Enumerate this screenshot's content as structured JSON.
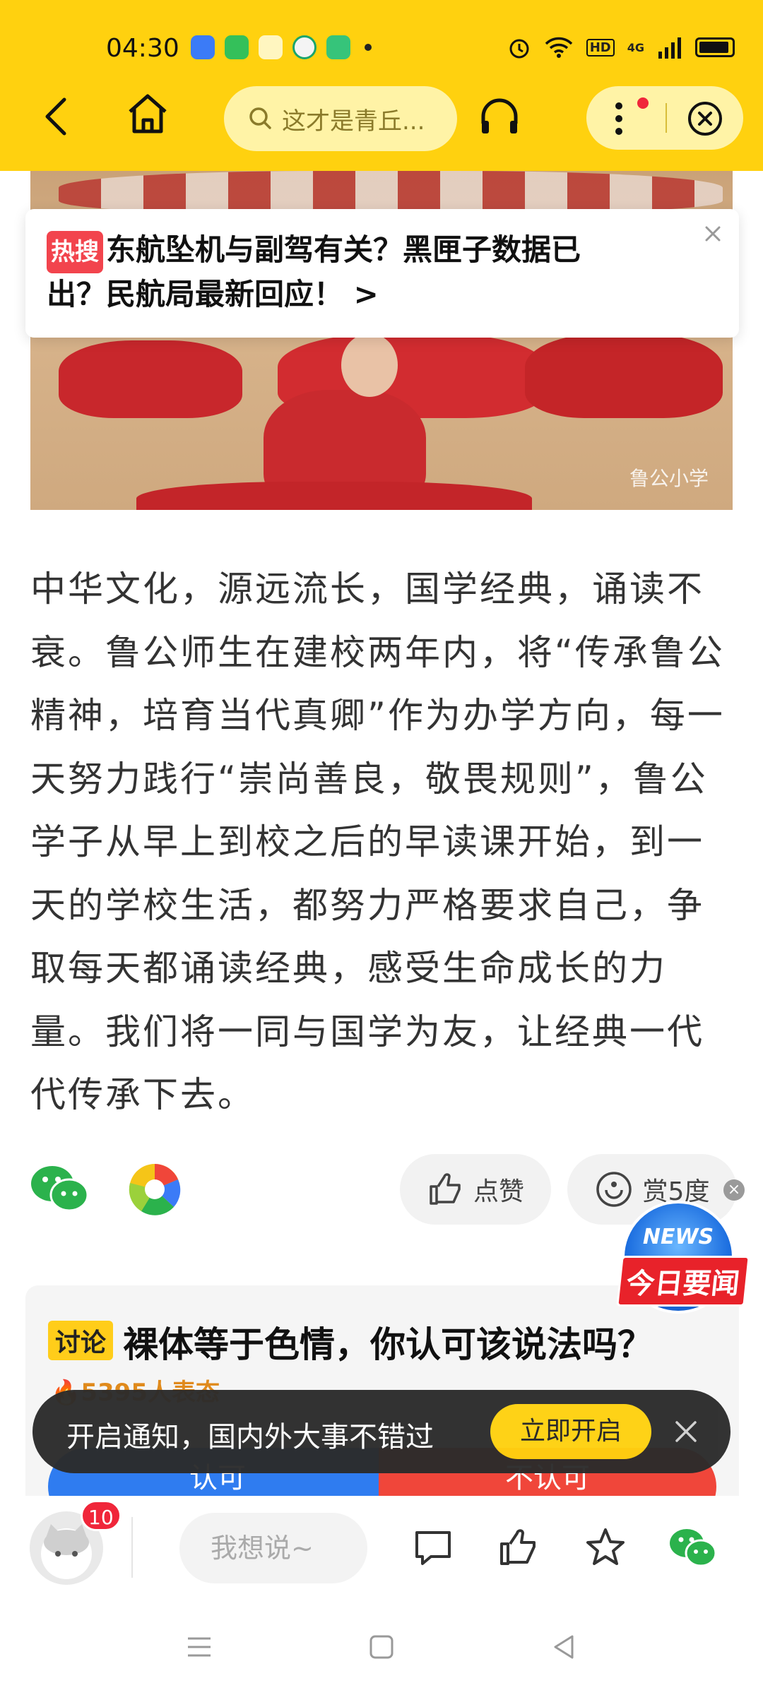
{
  "status_bar": {
    "time": "04:30",
    "hd": "HD",
    "network": "4G"
  },
  "toolbar": {
    "search_placeholder": "这才是青丘...",
    "icons": [
      "back-icon",
      "home-icon",
      "search-icon",
      "headphone-icon",
      "more-icon",
      "close-icon"
    ]
  },
  "photo": {
    "watermark": "鲁公小学"
  },
  "hot_search": {
    "badge": "热搜",
    "text_line1": "东航坠机与副驾有关？黑匣子数据已",
    "text_line2": "出？民航局最新回应！ >"
  },
  "article": {
    "paragraph": "中华文化，源远流长，国学经典，诵读不衰。鲁公师生在建校两年内，将“传承鲁公精神，培育当代真卿”作为办学方向，每一天努力践行“崇尚善良，敬畏规则”，鲁公学子从早上到校之后的早读课开始，到一天的学校生活，都努力严格要求自己，争取每天都诵读经典，感受生命成长的力量。我们将一同与国学为友，让经典一代代传承下去。"
  },
  "actions": {
    "like_label": "点赞",
    "reward_label": "赏5度"
  },
  "news_badge": {
    "en": "NEWS",
    "cn": "今日要闻"
  },
  "discussion": {
    "tag": "讨论",
    "question": "裸体等于色情，你认可该说法吗？",
    "count": "5395人表态",
    "agree": "认可",
    "disagree": "不认可"
  },
  "toast": {
    "text": "开启通知，国内外大事不错过",
    "button": "立即开启"
  },
  "bottom_bar": {
    "badge_count": "10",
    "comment_placeholder": "我想说~"
  },
  "colors": {
    "brand_yellow": "#ffd10f",
    "hot_red": "#f2444d",
    "agree_blue": "#2f7cf0",
    "disagree_red": "#f0463a"
  }
}
